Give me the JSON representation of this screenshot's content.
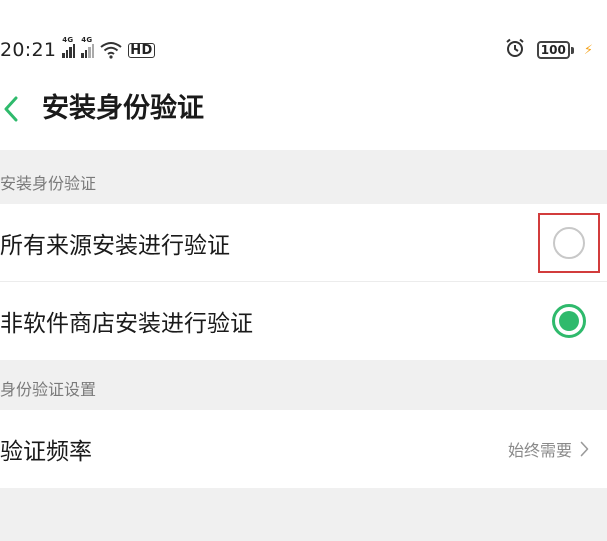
{
  "status_bar": {
    "time": "20:21",
    "signal1_tag": "4G",
    "signal2_tag": "4G",
    "hd_label": "HD",
    "battery_level": "100",
    "icons": [
      "signal-icon",
      "signal-icon",
      "wifi-icon",
      "hd-icon",
      "alarm-icon",
      "battery-icon",
      "charging-icon"
    ]
  },
  "header": {
    "back_icon": "chevron-left-icon",
    "title": "安装身份验证"
  },
  "sections": [
    {
      "header": "安装身份验证",
      "options": [
        {
          "label": "所有来源安装进行验证",
          "selected": false,
          "highlighted": true
        },
        {
          "label": "非软件商店安装进行验证",
          "selected": true,
          "highlighted": false
        }
      ]
    },
    {
      "header": "身份验证设置",
      "settings": [
        {
          "label": "验证频率",
          "value": "始终需要"
        }
      ]
    }
  ],
  "colors": {
    "accent": "#2fba6c",
    "highlight": "#d23c3c",
    "back_arrow": "#2fba6c"
  }
}
